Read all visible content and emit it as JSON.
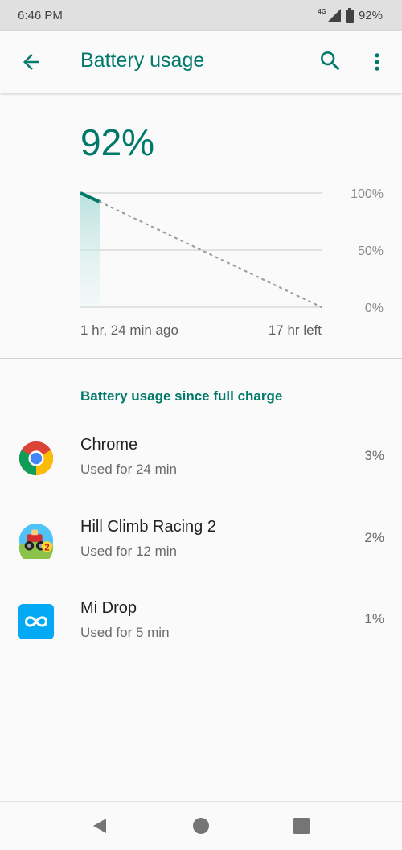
{
  "status_bar": {
    "time": "6:46 PM",
    "network": "4G",
    "battery": "92%"
  },
  "app_bar": {
    "title": "Battery usage"
  },
  "battery": {
    "level": "92%",
    "level_fraction": 0.92,
    "time_since": "1 hr, 24 min ago",
    "time_remaining": "17 hr left"
  },
  "chart_data": {
    "type": "line",
    "y_tick_labels": [
      "100%",
      "50%",
      "0%"
    ],
    "ylim": [
      0,
      100
    ],
    "series": [
      {
        "values_history": [
          100,
          92
        ]
      },
      {
        "projection": [
          92,
          0
        ]
      }
    ],
    "x_start_label": "1 hr, 24 min ago",
    "x_end_label": "17 hr left"
  },
  "section": {
    "title": "Battery usage since full charge"
  },
  "apps": [
    {
      "name": "Chrome",
      "detail": "Used for 24 min",
      "usage": "3%"
    },
    {
      "name": "Hill Climb Racing 2",
      "detail": "Used for 12 min",
      "usage": "2%"
    },
    {
      "name": "Mi Drop",
      "detail": "Used for 5 min",
      "usage": "1%"
    }
  ],
  "colors": {
    "accent": "#00796b",
    "mi_drop": "#03a9f4"
  }
}
